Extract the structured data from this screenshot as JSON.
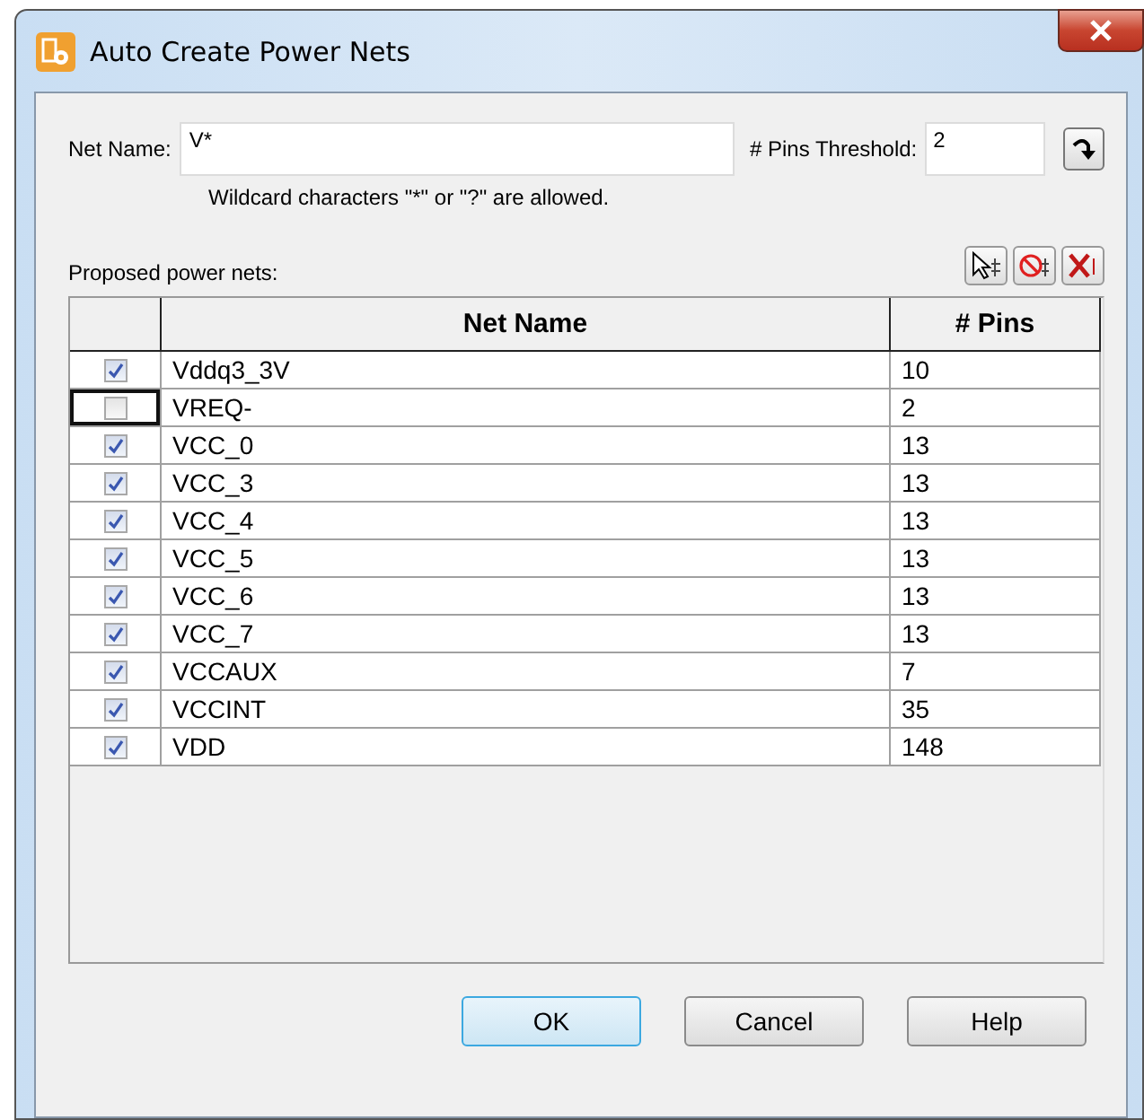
{
  "window": {
    "title": "Auto Create Power Nets"
  },
  "net_name": {
    "label": "Net Name:",
    "value": "V*",
    "hint": "Wildcard characters \"*\" or \"?\" are allowed."
  },
  "threshold": {
    "label": "# Pins Threshold:",
    "value": "2"
  },
  "list_label": "Proposed power nets:",
  "table": {
    "columns": [
      "Net Name",
      "# Pins"
    ],
    "rows": [
      {
        "checked": true,
        "focused": false,
        "name": "Vddq3_3V",
        "pins": "10"
      },
      {
        "checked": false,
        "focused": true,
        "name": "VREQ-",
        "pins": "2"
      },
      {
        "checked": true,
        "focused": false,
        "name": "VCC_0",
        "pins": "13"
      },
      {
        "checked": true,
        "focused": false,
        "name": "VCC_3",
        "pins": "13"
      },
      {
        "checked": true,
        "focused": false,
        "name": "VCC_4",
        "pins": "13"
      },
      {
        "checked": true,
        "focused": false,
        "name": "VCC_5",
        "pins": "13"
      },
      {
        "checked": true,
        "focused": false,
        "name": "VCC_6",
        "pins": "13"
      },
      {
        "checked": true,
        "focused": false,
        "name": "VCC_7",
        "pins": "13"
      },
      {
        "checked": true,
        "focused": false,
        "name": "VCCAUX",
        "pins": "7"
      },
      {
        "checked": true,
        "focused": false,
        "name": "VCCINT",
        "pins": "35"
      },
      {
        "checked": true,
        "focused": false,
        "name": "VDD",
        "pins": "148"
      }
    ]
  },
  "buttons": [
    {
      "label": "OK",
      "default": true
    },
    {
      "label": "Cancel",
      "default": false
    },
    {
      "label": "Help",
      "default": false
    }
  ]
}
